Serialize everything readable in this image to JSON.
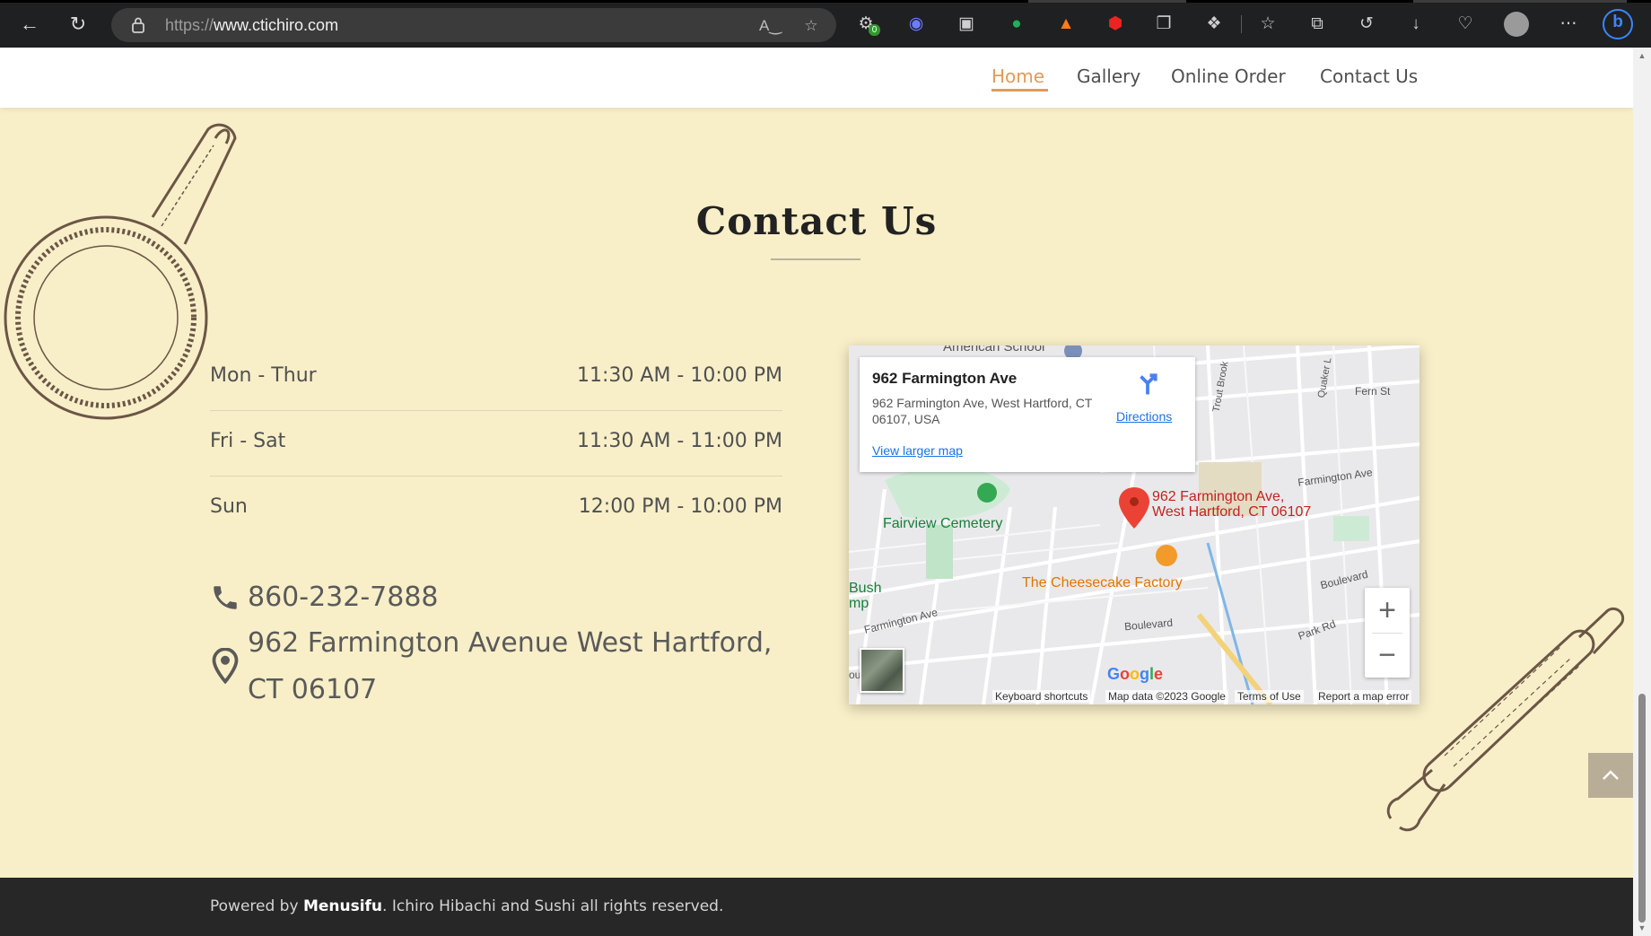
{
  "browser": {
    "url_prefix": "https://",
    "url_domain": "www.ctichiro.com",
    "extension_badge": "0"
  },
  "nav": {
    "items": [
      {
        "label": "Home",
        "active": true
      },
      {
        "label": "Gallery",
        "active": false
      },
      {
        "label": "Online Order",
        "active": false
      },
      {
        "label": "Contact Us",
        "active": false
      }
    ],
    "accent_color": "#e39a57"
  },
  "contact": {
    "heading": "Contact Us",
    "hours": [
      {
        "day": "Mon - Thur",
        "time": "11:30 AM - 10:00 PM"
      },
      {
        "day": "Fri - Sat",
        "time": "11:30 AM - 11:00 PM"
      },
      {
        "day": "Sun",
        "time": "12:00 PM - 10:00 PM"
      }
    ],
    "phone": "860-232-7888",
    "address_line1": "962 Farmington Avenue West Hartford,",
    "address_line2": "CT 06107"
  },
  "map": {
    "card_title": "962 Farmington Ave",
    "card_address": "962 Farmington Ave, West Hartford, CT 06107, USA",
    "directions_label": "Directions",
    "larger_map_label": "View larger map",
    "pin_label_line1": "962 Farmington Ave,",
    "pin_label_line2": "West Hartford, CT 06107",
    "labels": {
      "school": "American School",
      "trout": "Trout Brook",
      "quaker": "Quaker L",
      "fern": "Fern St",
      "farmington_ave_ne": "Farmington Ave",
      "cemetery": "Fairview Cemetery",
      "cheesecake": "The Cheesecake Factory",
      "bush": "Bush",
      "mp": "mp",
      "farmington_ave_sw": "Farmington Ave",
      "boulevard_mid": "Boulevard",
      "boulevard_e": "Boulevard",
      "park": "Park Rd",
      "ou": "ou"
    },
    "logo": "Google",
    "attribution": {
      "shortcuts": "Keyboard shortcuts",
      "data": "Map data ©2023 Google",
      "terms": "Terms of Use",
      "report": "Report a map error"
    },
    "zoom_in": "+",
    "zoom_out": "−"
  },
  "footer": {
    "prefix": "Powered by ",
    "brand": "Menusifu",
    "suffix": ". Ichiro Hibachi and Sushi all rights reserved."
  }
}
